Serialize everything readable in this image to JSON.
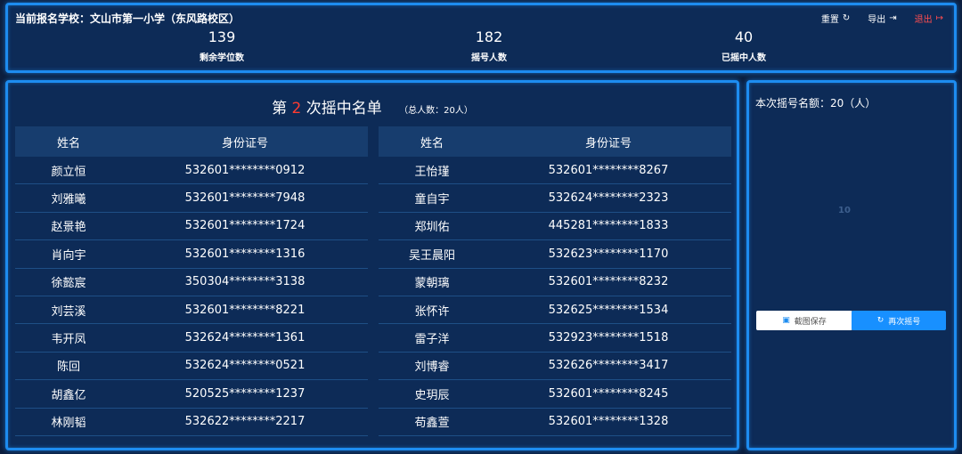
{
  "header": {
    "school_label": "当前报名学校：文山市第一小学（东风路校区）",
    "actions": {
      "reset": "重置",
      "export": "导出",
      "logout": "退出"
    },
    "stats": [
      {
        "value": "139",
        "label": "剩余学位数"
      },
      {
        "value": "182",
        "label": "摇号人数"
      },
      {
        "value": "40",
        "label": "已摇中人数"
      }
    ]
  },
  "list": {
    "title_prefix": "第",
    "round": "2",
    "title_suffix": "次摇中名单",
    "total": "（总人数：20人）",
    "columns": {
      "name": "姓名",
      "id": "身份证号"
    },
    "left_rows": [
      {
        "name": "颜立恒",
        "id": "532601********0912"
      },
      {
        "name": "刘雅曦",
        "id": "532601********7948"
      },
      {
        "name": "赵景艳",
        "id": "532601********1724"
      },
      {
        "name": "肖向宇",
        "id": "532601********1316"
      },
      {
        "name": "徐懿宸",
        "id": "350304********3138"
      },
      {
        "name": "刘芸溪",
        "id": "532601********8221"
      },
      {
        "name": "韦开凤",
        "id": "532624********1361"
      },
      {
        "name": "陈回",
        "id": "532624********0521"
      },
      {
        "name": "胡鑫亿",
        "id": "520525********1237"
      },
      {
        "name": "林刚韬",
        "id": "532622********2217"
      }
    ],
    "right_rows": [
      {
        "name": "王怡瑾",
        "id": "532601********8267"
      },
      {
        "name": "童自宇",
        "id": "532624********2323"
      },
      {
        "name": "郑圳佑",
        "id": "445281********1833"
      },
      {
        "name": "吴王晨阳",
        "id": "532623********1170"
      },
      {
        "name": "蒙朝璃",
        "id": "532601********8232"
      },
      {
        "name": "张怀许",
        "id": "532625********1534"
      },
      {
        "name": "雷子洋",
        "id": "532923********1518"
      },
      {
        "name": "刘博睿",
        "id": "532626********3417"
      },
      {
        "name": "史玥辰",
        "id": "532601********8245"
      },
      {
        "name": "苟鑫萱",
        "id": "532601********1328"
      }
    ]
  },
  "side": {
    "quota": "本次摇号名额：20（人）",
    "placeholder": "10",
    "save_button": "截图保存",
    "redraw_button": "再次摇号"
  },
  "icons": {
    "reset": "refresh-icon",
    "export": "export-icon",
    "logout": "logout-icon",
    "save": "save-icon",
    "redraw": "refresh-icon"
  },
  "colors": {
    "background": "#0c1e3e",
    "panel": "#0d2b57",
    "border": "#1d8cf0",
    "accent_red": "#ff3b30",
    "button_blue": "#1890ff"
  }
}
